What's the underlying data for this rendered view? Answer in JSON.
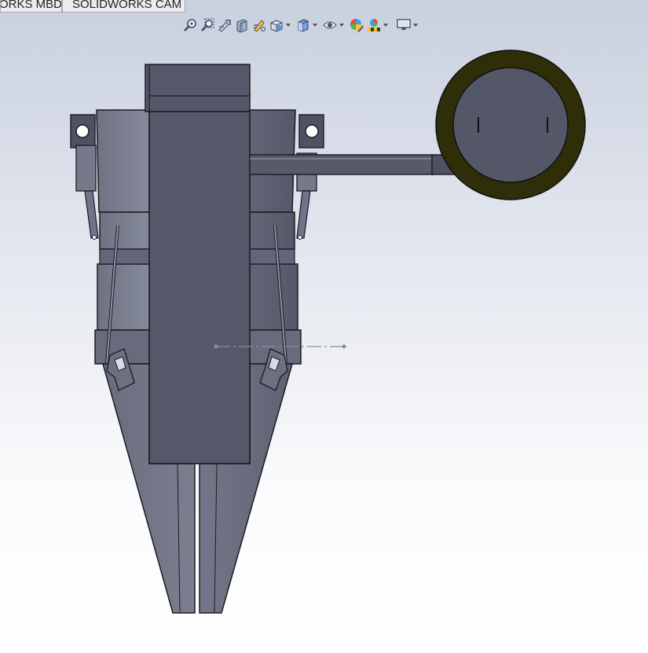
{
  "tabs": [
    {
      "label": "ORKS MBD",
      "id": "solidworks-mbd"
    },
    {
      "label": "SOLIDWORKS CAM",
      "id": "solidworks-cam"
    }
  ],
  "heads_up_toolbar": [
    {
      "icon": "zoom-to-fit-icon",
      "has_dropdown": false
    },
    {
      "icon": "zoom-to-area-icon",
      "has_dropdown": false
    },
    {
      "icon": "previous-view-icon",
      "has_dropdown": false
    },
    {
      "icon": "section-view-icon",
      "has_dropdown": false
    },
    {
      "icon": "dynamic-annotation-views-icon",
      "has_dropdown": false
    },
    {
      "icon": "view-orientation-icon",
      "has_dropdown": true
    },
    {
      "icon": "display-style-icon",
      "has_dropdown": true
    },
    {
      "icon": "hide-show-items-icon",
      "has_dropdown": true
    },
    {
      "icon": "edit-appearance-icon",
      "has_dropdown": false
    },
    {
      "icon": "apply-scene-icon",
      "has_dropdown": true
    },
    {
      "icon": "view-settings-icon",
      "has_dropdown": true
    }
  ],
  "colors": {
    "part_face": "#5b5e6d",
    "part_face_light": "#7d8192",
    "part_edge": "#1b1b22",
    "ring": "#2e2e08",
    "axis_line": "#8a8d99"
  }
}
